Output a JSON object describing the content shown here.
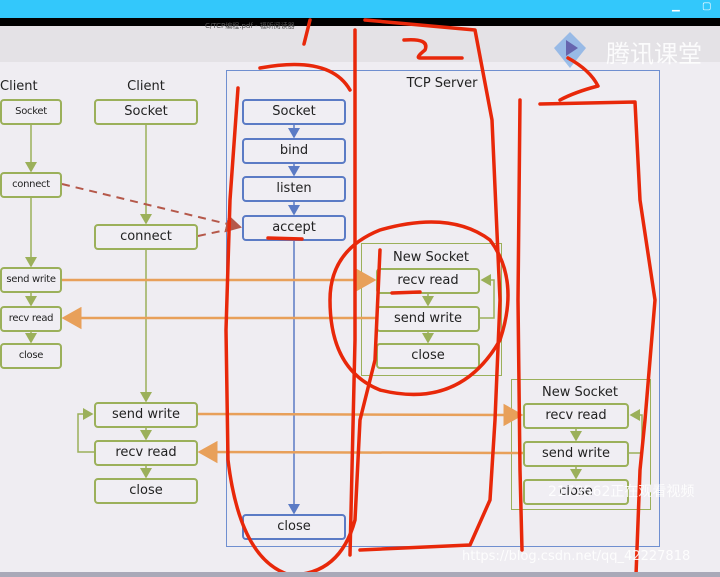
{
  "window": {
    "title": "C/TCP编程.pdf - 福昕阅读器",
    "logo_text": "腾讯课堂",
    "minimize_icon": "minimize-icon",
    "maximize_icon": "maximize-icon"
  },
  "diagram": {
    "client_left": {
      "label": "Client",
      "steps": [
        "Socket",
        "connect",
        "send write",
        "recv read",
        "close"
      ]
    },
    "client": {
      "label": "Client",
      "steps": [
        "Socket",
        "connect",
        "send write",
        "recv read",
        "close"
      ]
    },
    "server": {
      "label": "TCP Server",
      "steps": [
        "Socket",
        "bind",
        "listen",
        "accept",
        "close"
      ]
    },
    "new_socket_1": {
      "label": "New Socket",
      "steps": [
        "recv read",
        "send write",
        "close"
      ]
    },
    "new_socket_2": {
      "label": "New Socket",
      "steps": [
        "recv read",
        "send write",
        "close"
      ]
    }
  },
  "watermarks": {
    "viewer": "2173562正在观看视频",
    "url": "https://blog.csdn.net/qq_42227818"
  },
  "colors": {
    "client": "#9bb05a",
    "server": "#5b7bc5",
    "data_flow": "#e8a05a",
    "connect_flow": "#b5584a",
    "annotation": "#e8280a"
  }
}
